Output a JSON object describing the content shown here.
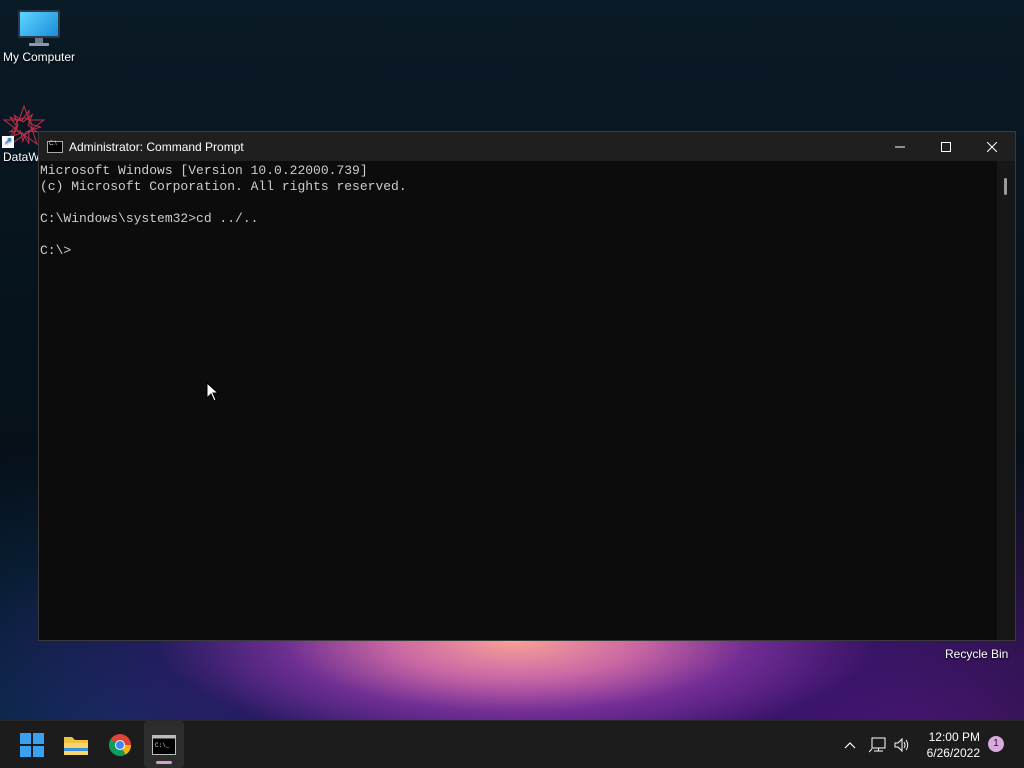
{
  "desktop": {
    "my_computer_label": "My Computer",
    "datawrapper_label": "DataW",
    "recycle_bin_label": "Recycle Bin"
  },
  "window": {
    "title": "Administrator: Command Prompt",
    "lines": [
      "Microsoft Windows [Version 10.0.22000.739]",
      "(c) Microsoft Corporation. All rights reserved.",
      "",
      "C:\\Windows\\system32>cd ../..",
      "",
      "C:\\>"
    ]
  },
  "taskbar": {
    "apps": [
      "start",
      "file-explorer",
      "chrome",
      "command-prompt"
    ],
    "time": "12:00 PM",
    "date": "6/26/2022",
    "notification_count": "1"
  },
  "colors": {
    "terminal_bg": "#0c0c0c",
    "terminal_fg": "#cccccc",
    "taskbar_bg": "#1c1c1c",
    "accent": "#0078d4"
  }
}
